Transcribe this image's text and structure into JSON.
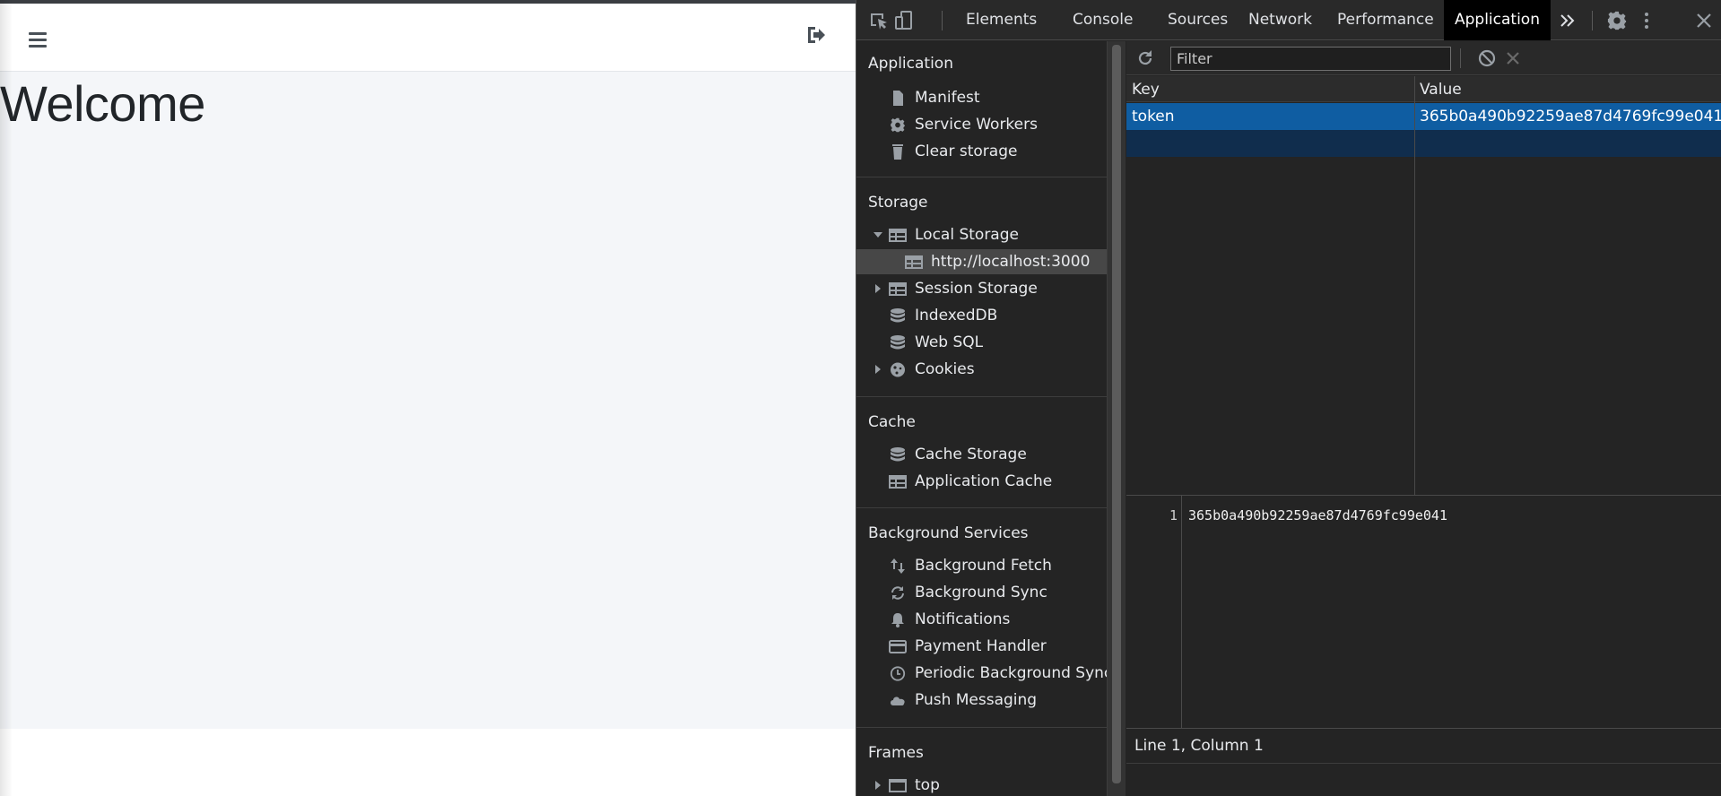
{
  "webpage": {
    "heading": "Welcome",
    "menu_icon": "hamburger-menu-icon",
    "logout_icon": "sign-out-icon"
  },
  "devtools": {
    "tabs": [
      {
        "label": "Elements"
      },
      {
        "label": "Console"
      },
      {
        "label": "Sources"
      },
      {
        "label": "Network"
      },
      {
        "label": "Performance"
      },
      {
        "label": "Application",
        "active": true
      }
    ],
    "more_tabs_icon": "double-chevron-right-icon",
    "toolbar_icons": [
      "inspect-element-icon",
      "device-toolbar-icon",
      "settings-gear-icon",
      "kebab-menu-icon",
      "close-icon"
    ],
    "sidebar": {
      "application": {
        "title": "Application",
        "items": [
          {
            "label": "Manifest",
            "icon": "document-icon"
          },
          {
            "label": "Service Workers",
            "icon": "gear-icon"
          },
          {
            "label": "Clear storage",
            "icon": "trash-icon"
          }
        ]
      },
      "storage": {
        "title": "Storage",
        "items": [
          {
            "label": "Local Storage",
            "icon": "table-icon",
            "expanded": true
          },
          {
            "label": "http://localhost:3000",
            "icon": "table-icon",
            "selected": true
          },
          {
            "label": "Session Storage",
            "icon": "table-icon",
            "expanded": false
          },
          {
            "label": "IndexedDB",
            "icon": "database-icon"
          },
          {
            "label": "Web SQL",
            "icon": "database-icon"
          },
          {
            "label": "Cookies",
            "icon": "cookie-icon",
            "expanded": false
          }
        ]
      },
      "cache": {
        "title": "Cache",
        "items": [
          {
            "label": "Cache Storage",
            "icon": "database-icon"
          },
          {
            "label": "Application Cache",
            "icon": "table-icon"
          }
        ]
      },
      "background_services": {
        "title": "Background Services",
        "items": [
          {
            "label": "Background Fetch",
            "icon": "up-down-arrows-icon"
          },
          {
            "label": "Background Sync",
            "icon": "sync-icon"
          },
          {
            "label": "Notifications",
            "icon": "bell-icon"
          },
          {
            "label": "Payment Handler",
            "icon": "credit-card-icon"
          },
          {
            "label": "Periodic Background Sync",
            "icon": "clock-icon"
          },
          {
            "label": "Push Messaging",
            "icon": "cloud-icon"
          }
        ]
      },
      "frames": {
        "title": "Frames",
        "items": [
          {
            "label": "top",
            "icon": "frame-window-icon",
            "expanded": false
          }
        ]
      }
    },
    "filter": {
      "placeholder": "Filter",
      "value": ""
    },
    "grid": {
      "columns": [
        "Key",
        "Value"
      ],
      "rows": [
        {
          "key": "token",
          "value": "365b0a490b92259ae87d4769fc99e041"
        }
      ]
    },
    "preview": {
      "line_number": "1",
      "text": "365b0a490b92259ae87d4769fc99e041"
    },
    "status": "Line 1, Column 1"
  }
}
